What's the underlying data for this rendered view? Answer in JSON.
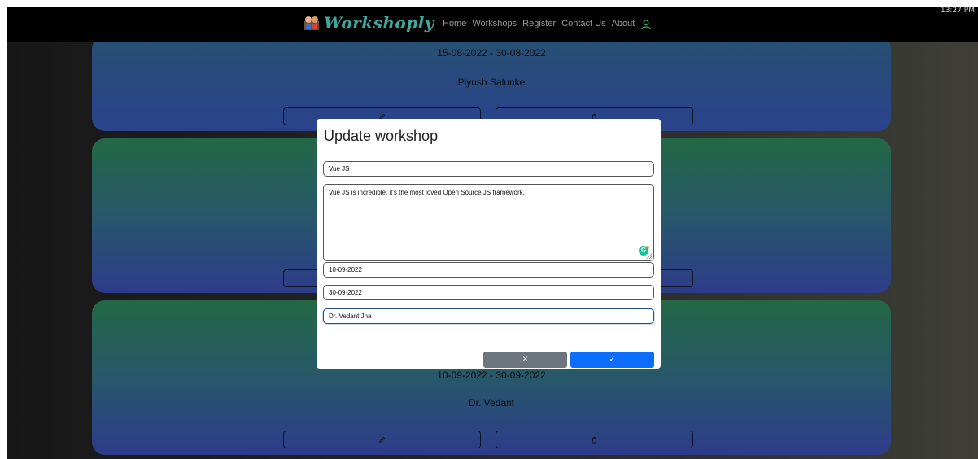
{
  "clock": "13:27 PM",
  "navbar": {
    "brand": "Workshoply",
    "links": [
      "Home",
      "Workshops",
      "Register",
      "Contact Us",
      "About"
    ]
  },
  "cards": [
    {
      "dates": "15-08-2022 - 30-08-2022",
      "name": "Piyush Salunke"
    },
    {
      "dates": "",
      "name": ""
    },
    {
      "dates": "10-09-2022 - 30-09-2022",
      "name": "Dr. Vedant"
    }
  ],
  "modal": {
    "title": "Update workshop",
    "name_value": "Vue JS",
    "description_value": "Vue JS is incredible, it's the most loved Open Source JS framework.",
    "start_date_value": "10-09-2022",
    "end_date_value": "30-09-2022",
    "instructor_value": "Dr. Vedant Jha",
    "cancel_label": "✕",
    "confirm_label": "✓"
  },
  "colors": {
    "navbar_bg": "#000000",
    "brand": "#3fa9a0",
    "cancel_button": "#6c757d",
    "confirm_button": "#0d6efd"
  },
  "icons": {
    "edit": "pencil-icon",
    "delete": "trash-icon",
    "user": "user-icon",
    "grammarly": "grammarly-icon"
  }
}
